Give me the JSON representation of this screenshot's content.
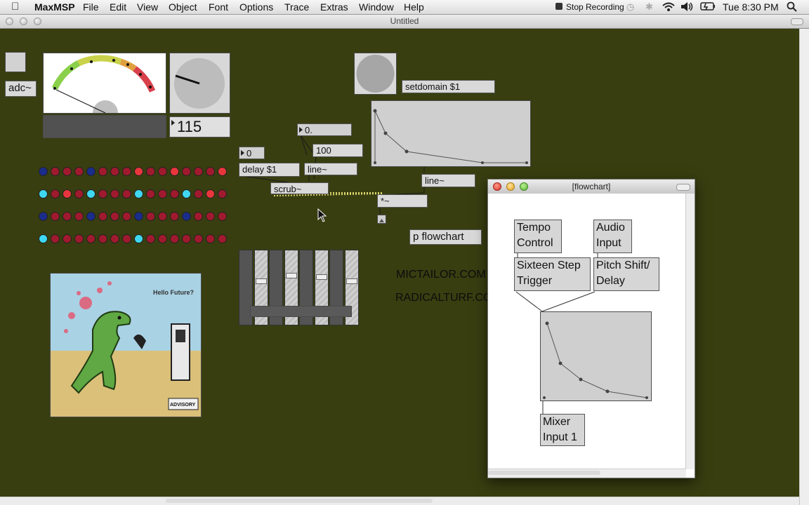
{
  "menubar": {
    "app_name": "MaxMSP",
    "menus": [
      "File",
      "Edit",
      "View",
      "Object",
      "Font",
      "Options",
      "Trace",
      "Extras",
      "Window",
      "Help"
    ],
    "stop_recording": "Stop Recording",
    "clock": "Tue 8:30 PM"
  },
  "window": {
    "title": "Untitled"
  },
  "patcher": {
    "adc_label": "adc~",
    "number_115": "115",
    "number_zero_float": "0.",
    "number_100": "100",
    "number_zero": "0",
    "delay_msg": "delay $1",
    "line_obj_1": "line~",
    "scrub_obj": "scrub~",
    "setdomain_msg": "setdomain $1",
    "line_obj_2": "line~",
    "mult_obj": "*~",
    "flowchart_obj": "p flowchart",
    "comment_1": "MICTAILOR.COM",
    "comment_2": "RADICALTURF.COM",
    "album_art_text": "Hello Future?",
    "album_badge": "ADVISORY",
    "led_rows": [
      [
        "navy",
        "red",
        "red",
        "red",
        "navy",
        "red",
        "red",
        "red",
        "red",
        "red",
        "red",
        "red",
        "red",
        "red",
        "red",
        "red"
      ],
      [
        "cyan",
        "red",
        "red",
        "red",
        "cyan",
        "red",
        "red",
        "red",
        "cyan",
        "red",
        "red",
        "red",
        "cyan",
        "red",
        "red",
        "red"
      ],
      [
        "navy",
        "red",
        "red",
        "red",
        "navy",
        "red",
        "red",
        "red",
        "navy",
        "red",
        "red",
        "red",
        "navy",
        "red",
        "red",
        "red"
      ],
      [
        "cyan",
        "red",
        "red",
        "red",
        "red",
        "red",
        "red",
        "red",
        "cyan",
        "red",
        "red",
        "red",
        "red",
        "red",
        "red",
        "red"
      ]
    ],
    "led_highlights": [
      [
        8,
        11,
        15
      ],
      [
        2,
        14
      ],
      [],
      []
    ],
    "slider_levels": [
      0.58,
      0.6,
      0.64,
      0.68,
      0.66,
      0.66,
      0.66,
      0.6
    ],
    "meter_color_ramp": [
      "#8ad04a",
      "#c9d24a",
      "#e0a040",
      "#d8404c"
    ],
    "dial_value": 0.72
  },
  "flowchart_window": {
    "title": "[flowchart]",
    "boxes": {
      "tempo": "Tempo\nControl",
      "audio": "Audio\nInput",
      "sixteen": "Sixteen Step\nTrigger",
      "pitch": "Pitch Shift/\nDelay",
      "mixer": "Mixer\nInput 1"
    }
  }
}
